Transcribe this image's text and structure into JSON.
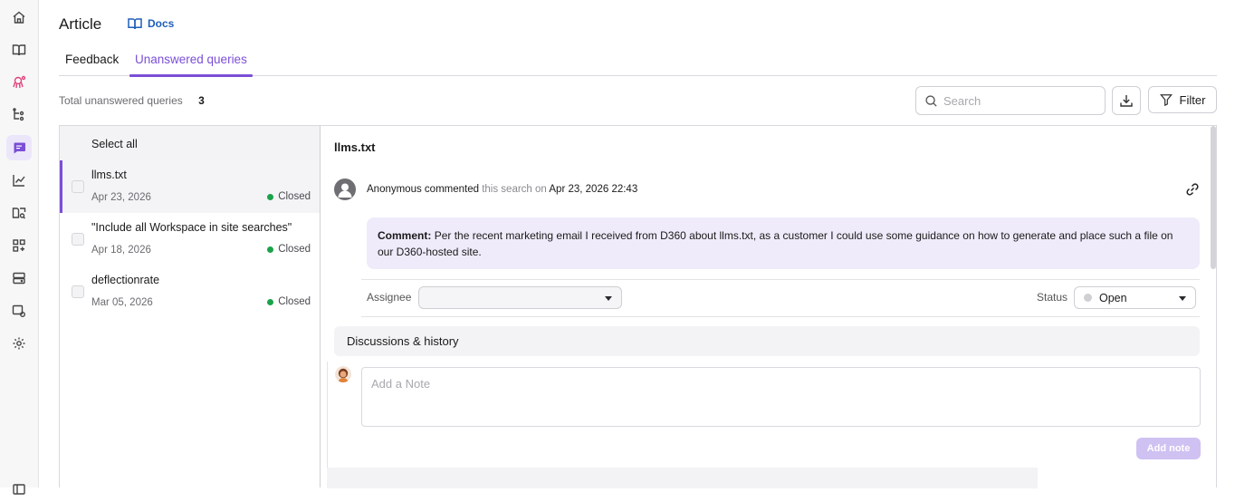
{
  "header": {
    "title": "Article",
    "docs_label": "Docs"
  },
  "tabs": [
    {
      "label": "Feedback",
      "active": false
    },
    {
      "label": "Unanswered queries",
      "active": true
    }
  ],
  "summary": {
    "label": "Total unanswered queries",
    "count": "3"
  },
  "search": {
    "placeholder": "Search"
  },
  "toolbar": {
    "filter_label": "Filter"
  },
  "list": {
    "select_all_label": "Select all",
    "items": [
      {
        "title": "llms.txt",
        "date": "Apr 23, 2026",
        "status": "Closed",
        "selected": true
      },
      {
        "title": "\"Include all Workspace in site searches\"",
        "date": "Apr 18, 2026",
        "status": "Closed",
        "selected": false
      },
      {
        "title": "deflectionrate",
        "date": "Mar 05, 2026",
        "status": "Closed",
        "selected": false
      }
    ]
  },
  "detail": {
    "title": "llms.txt",
    "author": "Anonymous commented",
    "context": "this search on",
    "timestamp": "Apr 23, 2026 22:43",
    "comment_label": "Comment:",
    "comment_text": "Per the recent marketing email I received from D360 about llms.txt, as a customer I could use some guidance on how to generate and place such a file on our D360-hosted site.",
    "assignee_label": "Assignee",
    "assignee_value": "",
    "status_label": "Status",
    "status_value": "Open",
    "discussions_label": "Discussions & history",
    "note_placeholder": "Add a Note",
    "add_note_label": "Add note"
  },
  "colors": {
    "accent": "#7b4fd6",
    "status_closed": "#1aa34a",
    "link": "#1f5fb8"
  }
}
